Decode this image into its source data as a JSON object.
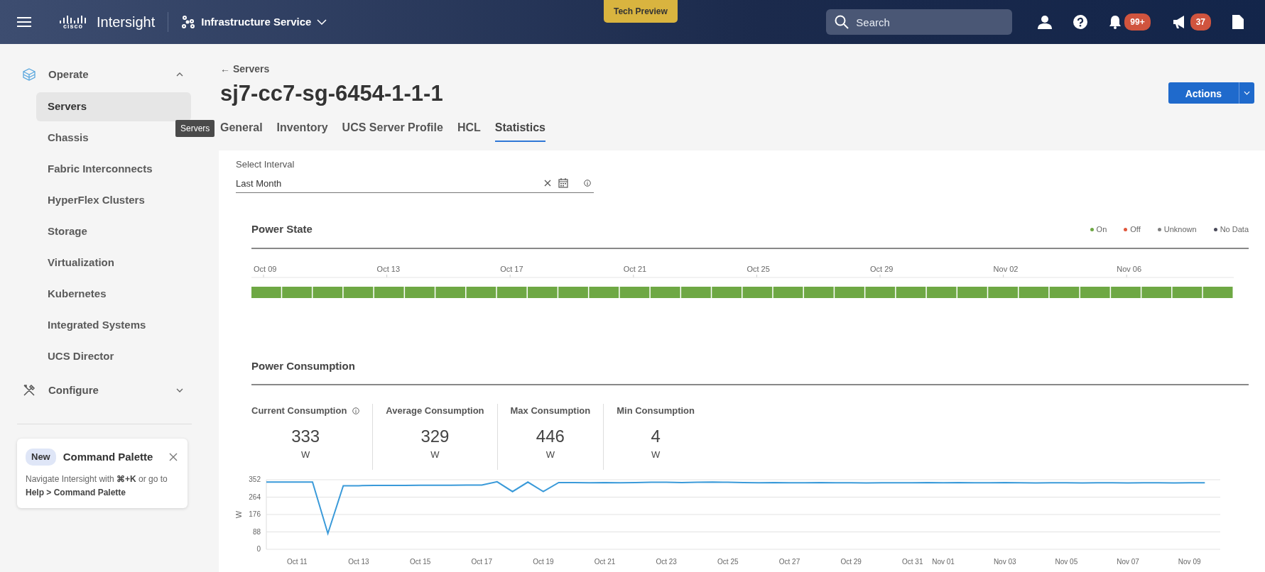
{
  "header": {
    "app_name": "Intersight",
    "logo_text": "cisco",
    "service": "Infrastructure Service",
    "badge": "Tech Preview",
    "search": {
      "placeholder": "Search"
    },
    "notifications": "99+",
    "announcements": "37"
  },
  "sidebar": {
    "sections": [
      {
        "label": "Operate",
        "expanded": true,
        "items": [
          {
            "label": "Servers",
            "selected": true
          },
          {
            "label": "Chassis",
            "selected": false
          },
          {
            "label": "Fabric Interconnects",
            "selected": false
          },
          {
            "label": "HyperFlex Clusters",
            "selected": false
          },
          {
            "label": "Storage",
            "selected": false
          },
          {
            "label": "Virtualization",
            "selected": false
          },
          {
            "label": "Kubernetes",
            "selected": false
          },
          {
            "label": "Integrated Systems",
            "selected": false
          },
          {
            "label": "UCS Director",
            "selected": false
          }
        ]
      },
      {
        "label": "Configure",
        "expanded": false
      }
    ],
    "tooltip": "Servers",
    "command_palette": {
      "badge": "New",
      "title": "Command Palette",
      "text": "Navigate Intersight with **⌘+K** or go to **Help > Command Palette**"
    }
  },
  "breadcrumb": "← Servers",
  "title": "sj7-cc7-sg-6454-1-1-1",
  "actions_button": "Actions",
  "tabs": [
    {
      "label": "General",
      "selected": false
    },
    {
      "label": "Inventory",
      "selected": false
    },
    {
      "label": "UCS Server Profile",
      "selected": false
    },
    {
      "label": "HCL",
      "selected": false
    },
    {
      "label": "Statistics",
      "selected": true
    }
  ],
  "interval": {
    "label": "Select Interval",
    "value": "Last Month"
  },
  "power_state": {
    "title": "Power State",
    "legend": [
      {
        "label": "On",
        "color": "#6ea844"
      },
      {
        "label": "Off",
        "color": "#e0573c"
      },
      {
        "label": "Unknown",
        "color": "#7f7f7f"
      },
      {
        "label": "No Data",
        "color": "#4a4a5a"
      }
    ],
    "axis_labels": [
      "Oct 09",
      "Oct 13",
      "Oct 17",
      "Oct 21",
      "Oct 25",
      "Oct 29",
      "Nov 02",
      "Nov 06"
    ],
    "segments": [
      {
        "color": "#6ea844"
      },
      {
        "color": "#6ea844"
      },
      {
        "color": "#6ea844"
      },
      {
        "color": "#6ea844"
      },
      {
        "color": "#6ea844"
      },
      {
        "color": "#6ea844"
      },
      {
        "color": "#6ea844"
      },
      {
        "color": "#6ea844"
      },
      {
        "color": "#6ea844"
      },
      {
        "color": "#6ea844"
      },
      {
        "color": "#6ea844"
      },
      {
        "color": "#6ea844"
      },
      {
        "color": "#6ea844"
      },
      {
        "color": "#6ea844"
      },
      {
        "color": "#6ea844"
      },
      {
        "color": "#6ea844"
      },
      {
        "color": "#6ea844"
      },
      {
        "color": "#6ea844"
      },
      {
        "color": "#6ea844"
      },
      {
        "color": "#6ea844"
      },
      {
        "color": "#6ea844"
      },
      {
        "color": "#6ea844"
      },
      {
        "color": "#6ea844"
      },
      {
        "color": "#6ea844"
      },
      {
        "color": "#6ea844"
      },
      {
        "color": "#6ea844"
      },
      {
        "color": "#6ea844"
      },
      {
        "color": "#6ea844"
      },
      {
        "color": "#6ea844"
      },
      {
        "color": "#6ea844"
      },
      {
        "color": "#6ea844"
      },
      {
        "color": "#6ea844"
      }
    ]
  },
  "power_consumption": {
    "title": "Power Consumption",
    "kpis": [
      {
        "label": "Current Consumption",
        "info_icon": true,
        "value": "333",
        "unit": "W"
      },
      {
        "label": "Average Consumption",
        "info_icon": false,
        "value": "329",
        "unit": "W"
      },
      {
        "label": "Max Consumption",
        "info_icon": false,
        "value": "446",
        "unit": "W"
      },
      {
        "label": "Min Consumption",
        "info_icon": false,
        "value": "4",
        "unit": "W"
      }
    ],
    "chart_data": {
      "type": "line",
      "grid": true,
      "ylabel": "W",
      "ylim": [
        0,
        352
      ],
      "yticks": [
        0,
        88,
        176,
        264,
        352
      ],
      "categories": [
        null,
        null,
        "Oct 11",
        null,
        null,
        null,
        "Oct 13",
        null,
        null,
        null,
        "Oct 15",
        null,
        null,
        null,
        "Oct 17",
        null,
        null,
        null,
        "Oct 19",
        null,
        null,
        null,
        "Oct 21",
        null,
        null,
        null,
        "Oct 23",
        null,
        null,
        null,
        "Oct 25",
        null,
        null,
        null,
        "Oct 27",
        null,
        null,
        null,
        "Oct 29",
        null,
        null,
        null,
        "Oct 31",
        null,
        "Nov 01",
        null,
        null,
        null,
        "Nov 03",
        null,
        null,
        null,
        "Nov 05",
        null,
        null,
        null,
        "Nov 07",
        null,
        null,
        null,
        "Nov 09",
        null
      ],
      "series": [
        {
          "color": "#3a9ad9",
          "values": [
            340,
            340,
            340,
            340,
            80,
            322,
            322,
            323,
            323,
            323,
            324,
            324,
            324,
            325,
            325,
            342,
            292,
            340,
            292,
            338,
            338,
            337,
            338,
            337,
            338,
            339,
            339,
            338,
            339,
            340,
            339,
            338,
            337,
            338,
            337,
            337,
            338,
            337,
            337,
            336,
            337,
            337,
            337,
            338,
            337,
            338,
            337,
            337,
            338,
            337,
            336,
            337,
            337,
            336,
            337,
            337,
            336,
            337,
            337,
            336,
            337,
            337
          ]
        }
      ]
    }
  }
}
